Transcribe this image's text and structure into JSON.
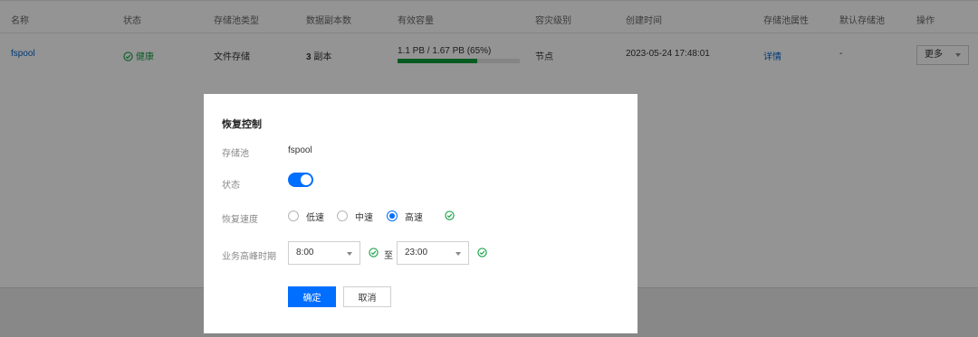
{
  "table": {
    "headers": [
      "名称",
      "状态",
      "存储池类型",
      "数据副本数",
      "有效容量",
      "容灾级别",
      "创建时间",
      "存储池属性",
      "默认存储池",
      "操作"
    ],
    "row": {
      "name": "fspool",
      "status": "健康",
      "type": "文件存储",
      "replica_count": "3",
      "replica_unit": " 副本",
      "capacity": "1.1 PB / 1.67 PB (65%)",
      "capacity_percent": 65,
      "dr_level": "节点",
      "created": "2023-05-24 17:48:01",
      "attributes_link": "详情",
      "default_pool": "-",
      "more_button": "更多"
    }
  },
  "dialog": {
    "title": "恢复控制",
    "pool_label": "存储池",
    "pool_value": "fspool",
    "status_label": "状态",
    "status_on": true,
    "speed_label": "恢复速度",
    "speed_options": [
      "低速",
      "中速",
      "高速"
    ],
    "speed_selected": "高速",
    "peak_label": "业务高峰时期",
    "peak_start": "8:00",
    "peak_to": "至",
    "peak_end": "23:00",
    "confirm_button": "确定",
    "cancel_button": "取消"
  },
  "colors": {
    "primary": "#006eff",
    "success": "#1aa34a",
    "progress_fill": "#0b9d3c"
  }
}
